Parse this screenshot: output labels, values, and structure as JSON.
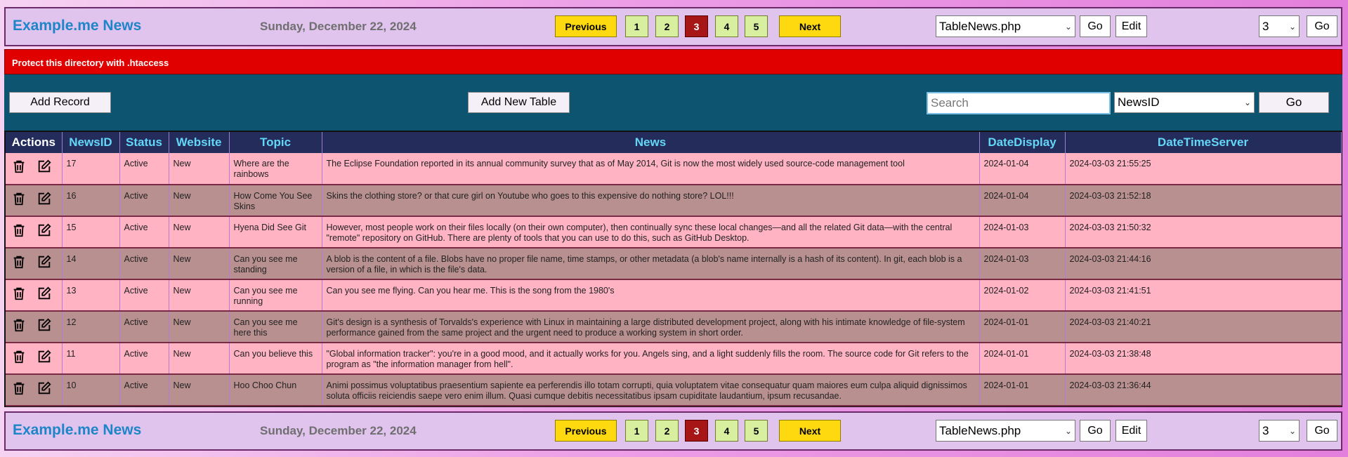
{
  "nav": {
    "brand": "Example.me News",
    "date": "Sunday, December 22, 2024",
    "previous": "Previous",
    "next": "Next",
    "pages": [
      "1",
      "2",
      "3",
      "4",
      "5"
    ],
    "current_page": "3",
    "file_select": "TableNews.php",
    "go": "Go",
    "edit": "Edit",
    "page_select": "3"
  },
  "warning": "Protect this directory with .htaccess",
  "toolbar": {
    "add_record": "Add Record",
    "add_table": "Add New Table",
    "search_placeholder": "Search",
    "field_select": "NewsID",
    "go": "Go"
  },
  "table": {
    "headers": [
      "Actions",
      "NewsID",
      "Status",
      "Website",
      "Topic",
      "News",
      "DateDisplay",
      "DateTimeServer"
    ],
    "rows": [
      {
        "id": "17",
        "status": "Active",
        "website": "New",
        "topic": "Where are the rainbows",
        "news": "The Eclipse Foundation reported in its annual community survey that as of May 2014, Git is now the most widely used source-code management tool",
        "date": "2024-01-04",
        "datetime": "2024-03-03 21:55:25"
      },
      {
        "id": "16",
        "status": "Active",
        "website": "New",
        "topic": "How Come You See Skins",
        "news": "Skins the clothing store? or that cure girl on Youtube who goes to this expensive do nothing store? LOL!!!",
        "date": "2024-01-04",
        "datetime": "2024-03-03 21:52:18"
      },
      {
        "id": "15",
        "status": "Active",
        "website": "New",
        "topic": "Hyena Did See Git",
        "news": "However, most people work on their files locally (on their own computer), then continually sync these local changes—and all the related Git data—with the central \"remote\" repository on GitHub. There are plenty of tools that you can use to do this, such as GitHub Desktop.",
        "date": "2024-01-03",
        "datetime": "2024-03-03 21:50:32"
      },
      {
        "id": "14",
        "status": "Active",
        "website": "New",
        "topic": "Can you see me standing",
        "news": "A blob is the content of a file. Blobs have no proper file name, time stamps, or other metadata (a blob's name internally is a hash of its content). In git, each blob is a version of a file, in which is the file's data.",
        "date": "2024-01-03",
        "datetime": "2024-03-03 21:44:16"
      },
      {
        "id": "13",
        "status": "Active",
        "website": "New",
        "topic": "Can you see me running",
        "news": "Can you see me flying. Can you hear me. This is the song from the 1980's",
        "date": "2024-01-02",
        "datetime": "2024-03-03 21:41:51"
      },
      {
        "id": "12",
        "status": "Active",
        "website": "New",
        "topic": "Can you see me here this",
        "news": "Git's design is a synthesis of Torvalds's experience with Linux in maintaining a large distributed development project, along with his intimate knowledge of file-system performance gained from the same project and the urgent need to produce a working system in short order.",
        "date": "2024-01-01",
        "datetime": "2024-03-03 21:40:21"
      },
      {
        "id": "11",
        "status": "Active",
        "website": "New",
        "topic": "Can you believe this",
        "news": "\"Global information tracker\": you're in a good mood, and it actually works for you. Angels sing, and a light suddenly fills the room. The source code for Git refers to the program as \"the information manager from hell\".",
        "date": "2024-01-01",
        "datetime": "2024-03-03 21:38:48"
      },
      {
        "id": "10",
        "status": "Active",
        "website": "New",
        "topic": "Hoo Choo Chun",
        "news": "Animi possimus voluptatibus praesentium sapiente ea perferendis illo totam corrupti, quia voluptatem vitae consequatur quam maiores eum culpa aliquid dignissimos soluta officiis reiciendis saepe vero enim illum. Quasi cumque debitis necessitatibus ipsam cupiditate laudantium, ipsum recusandae.",
        "date": "2024-01-01",
        "datetime": "2024-03-03 21:36:44"
      }
    ]
  },
  "icons": {
    "delete": "trash-icon",
    "edit": "edit-icon"
  }
}
